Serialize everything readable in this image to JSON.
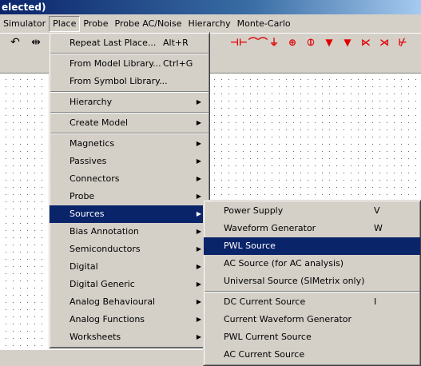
{
  "window": {
    "title": "elected)"
  },
  "menubar": [
    {
      "label": "Simulator",
      "active": false
    },
    {
      "label": "Place",
      "active": true
    },
    {
      "label": "Probe",
      "active": false
    },
    {
      "label": "Probe AC/Noise",
      "active": false
    },
    {
      "label": "Hierarchy",
      "active": false
    },
    {
      "label": "Monte-Carlo",
      "active": false
    }
  ],
  "toolbar": {
    "icons": [
      {
        "name": "undo-arrow-icon",
        "glyph": "↶"
      },
      {
        "name": "flip-icon",
        "glyph": "⇹"
      }
    ],
    "component_icons": [
      {
        "name": "capacitor-icon",
        "glyph": "⊣⊢"
      },
      {
        "name": "inductor-icon",
        "glyph": "⌒⌒"
      },
      {
        "name": "ground-icon",
        "glyph": "⏚"
      },
      {
        "name": "voltage-source-icon",
        "glyph": "⊕"
      },
      {
        "name": "current-source-icon",
        "glyph": "⦶"
      },
      {
        "name": "diode-icon",
        "glyph": "▼"
      },
      {
        "name": "zener-diode-icon",
        "glyph": "▼"
      },
      {
        "name": "npn-transistor-icon",
        "glyph": "⋉"
      },
      {
        "name": "pnp-transistor-icon",
        "glyph": "⋊"
      },
      {
        "name": "mosfet-icon",
        "glyph": "⊬"
      }
    ],
    "colors": {
      "component": "#e00000"
    }
  },
  "place_menu": {
    "items": [
      {
        "label": "Repeat Last Place...",
        "shortcut": "Alt+R",
        "submenu": false
      },
      {
        "sep": true
      },
      {
        "label": "From Model Library...",
        "shortcut": "Ctrl+G",
        "submenu": false
      },
      {
        "label": "From Symbol Library...",
        "shortcut": "",
        "submenu": false
      },
      {
        "sep": true
      },
      {
        "label": "Hierarchy",
        "shortcut": "",
        "submenu": true
      },
      {
        "sep": true
      },
      {
        "label": "Create Model",
        "shortcut": "",
        "submenu": true
      },
      {
        "sep": true
      },
      {
        "label": "Magnetics",
        "shortcut": "",
        "submenu": true
      },
      {
        "label": "Passives",
        "shortcut": "",
        "submenu": true
      },
      {
        "label": "Connectors",
        "shortcut": "",
        "submenu": true
      },
      {
        "label": "Probe",
        "shortcut": "",
        "submenu": true
      },
      {
        "label": "Sources",
        "shortcut": "",
        "submenu": true,
        "highlighted": true
      },
      {
        "label": "Bias Annotation",
        "shortcut": "",
        "submenu": true
      },
      {
        "label": "Semiconductors",
        "shortcut": "",
        "submenu": true
      },
      {
        "label": "Digital",
        "shortcut": "",
        "submenu": true
      },
      {
        "label": "Digital Generic",
        "shortcut": "",
        "submenu": true
      },
      {
        "label": "Analog Behavioural",
        "shortcut": "",
        "submenu": true
      },
      {
        "label": "Analog Functions",
        "shortcut": "",
        "submenu": true
      },
      {
        "label": "Worksheets",
        "shortcut": "",
        "submenu": true
      }
    ]
  },
  "sources_menu": {
    "items": [
      {
        "label": "Power Supply",
        "shortcut": "V"
      },
      {
        "label": "Waveform Generator",
        "shortcut": "W"
      },
      {
        "label": "PWL Source",
        "shortcut": "",
        "highlighted": true
      },
      {
        "label": "AC Source (for AC analysis)",
        "shortcut": ""
      },
      {
        "label": "Universal Source (SIMetrix only)",
        "shortcut": ""
      },
      {
        "sep": true
      },
      {
        "label": "DC Current Source",
        "shortcut": "I"
      },
      {
        "label": "Current Waveform Generator",
        "shortcut": ""
      },
      {
        "label": "PWL Current Source",
        "shortcut": ""
      },
      {
        "label": "AC Current Source",
        "shortcut": ""
      }
    ]
  },
  "highlight_color": "#0a246a"
}
